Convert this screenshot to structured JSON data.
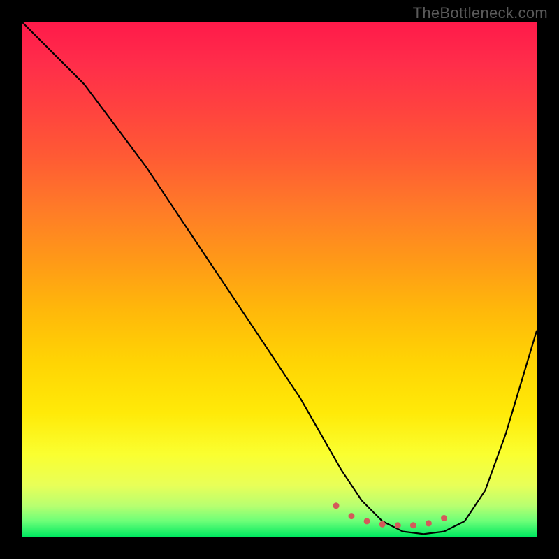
{
  "watermark": "TheBottleneck.com",
  "chart_data": {
    "type": "line",
    "title": "",
    "xlabel": "",
    "ylabel": "",
    "xlim": [
      0,
      100
    ],
    "ylim": [
      0,
      100
    ],
    "series": [
      {
        "name": "curve",
        "x": [
          0,
          3,
          6,
          12,
          18,
          24,
          30,
          36,
          42,
          48,
          54,
          58,
          62,
          66,
          70,
          74,
          78,
          82,
          86,
          90,
          94,
          100
        ],
        "values": [
          100,
          97,
          94,
          88,
          80,
          72,
          63,
          54,
          45,
          36,
          27,
          20,
          13,
          7,
          3,
          1,
          0.5,
          1,
          3,
          9,
          20,
          40
        ]
      }
    ],
    "highlight_dots": {
      "name": "red-dots",
      "x": [
        61,
        64,
        67,
        70,
        73,
        76,
        79,
        82
      ],
      "values": [
        6,
        4,
        3,
        2.4,
        2.2,
        2.2,
        2.6,
        3.6
      ]
    },
    "colors": {
      "curve": "#000000",
      "dots": "#d45a5a",
      "gradient_top": "#ff1a4a",
      "gradient_bottom": "#00e860"
    }
  }
}
